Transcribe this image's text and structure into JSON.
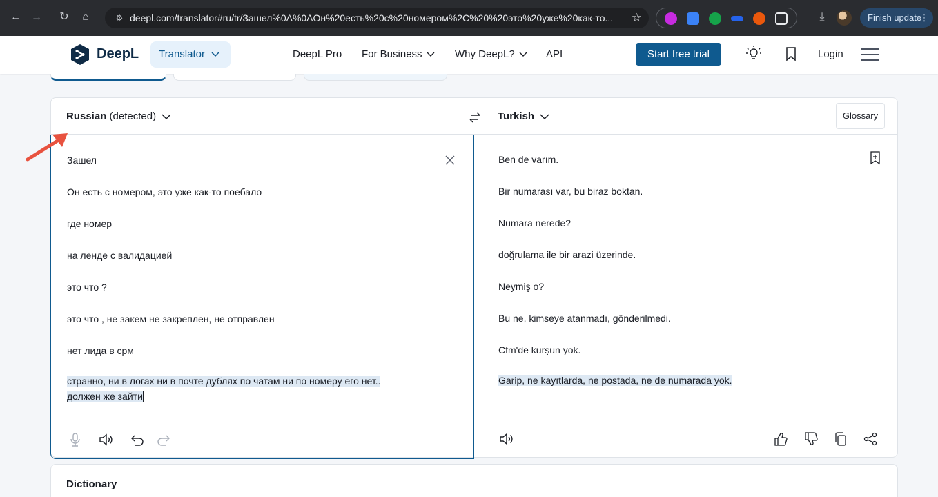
{
  "browser": {
    "url": "deepl.com/translator#ru/tr/Зашел%0A%0AОн%20есть%20с%20номером%2C%20%20это%20уже%20как-то...",
    "finish_update": "Finish update"
  },
  "header": {
    "brand": "DeepL",
    "translator_label": "Translator",
    "nav": [
      "DeepL Pro",
      "For Business",
      "Why DeepL?",
      "API"
    ],
    "cta": "Start free trial",
    "login": "Login"
  },
  "translator": {
    "source_lang": "Russian",
    "source_detected": "(detected)",
    "target_lang": "Turkish",
    "glossary": "Glossary",
    "source_lines": [
      "Зашел",
      "Он есть с номером,  это уже как-то поебало",
      "где номер",
      "на ленде с валидацией",
      "это что ?",
      "это что , не закем не закреплен, не отправлен",
      "нет лида в срм",
      "странно, ни в логах ни в почте дублях по чатам ни по номеру его нет..",
      "должен же зайти"
    ],
    "target_lines": [
      "Ben de varım.",
      "Bir numarası var, bu biraz boktan.",
      "Numara nerede?",
      "doğrulama ile bir arazi üzerinde.",
      "Neymiş o?",
      "Bu ne, kimseye atanmadı, gönderilmedi.",
      "Cfm'de kurşun yok.",
      "Garip, ne kayıtlarda, ne postada, ne de numarada yok."
    ]
  },
  "dictionary": {
    "title": "Dictionary"
  },
  "colors": {
    "brand": "#0f2b46",
    "accent": "#0f5a8f",
    "highlight": "#dde8f3",
    "annotation_arrow": "#e8523f"
  }
}
